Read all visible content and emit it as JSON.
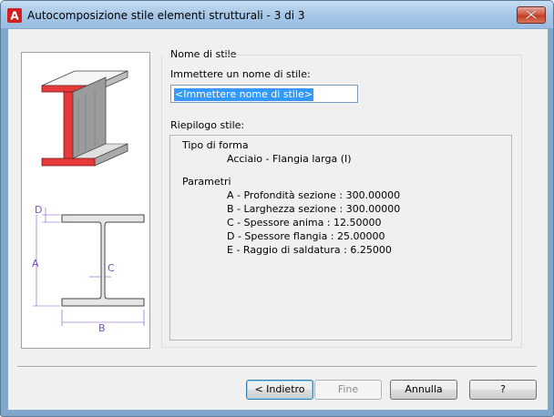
{
  "window": {
    "title": "Autocomposizione stile elementi strutturali - 3 di 3",
    "app_icon_letter": "A"
  },
  "style_name": {
    "group_label": "Nome di stile",
    "prompt_label": "Immettere un nome di stile:",
    "input_value": "<Immettere nome di stile>"
  },
  "summary": {
    "label": "Riepilogo stile:",
    "shape_type_heading": "Tipo di forma",
    "shape_type_value": "Acciaio - Flangia larga (I)",
    "parameters_heading": "Parametri",
    "parameters": [
      "A - Profondità sezione : 300.00000",
      "B - Larghezza sezione : 300.00000",
      "C - Spessore anima : 12.50000",
      "D - Spessore flangia : 25.00000",
      "E - Raggio di saldatura : 6.25000"
    ]
  },
  "diagram": {
    "labels": {
      "a": "A",
      "b": "B",
      "c": "C",
      "d": "D"
    },
    "dimension_color": "#7b4bc8",
    "accent_color": "#e63a3a"
  },
  "buttons": {
    "back": "< Indietro",
    "finish": "Fine",
    "cancel": "Annulla",
    "help": "?"
  }
}
